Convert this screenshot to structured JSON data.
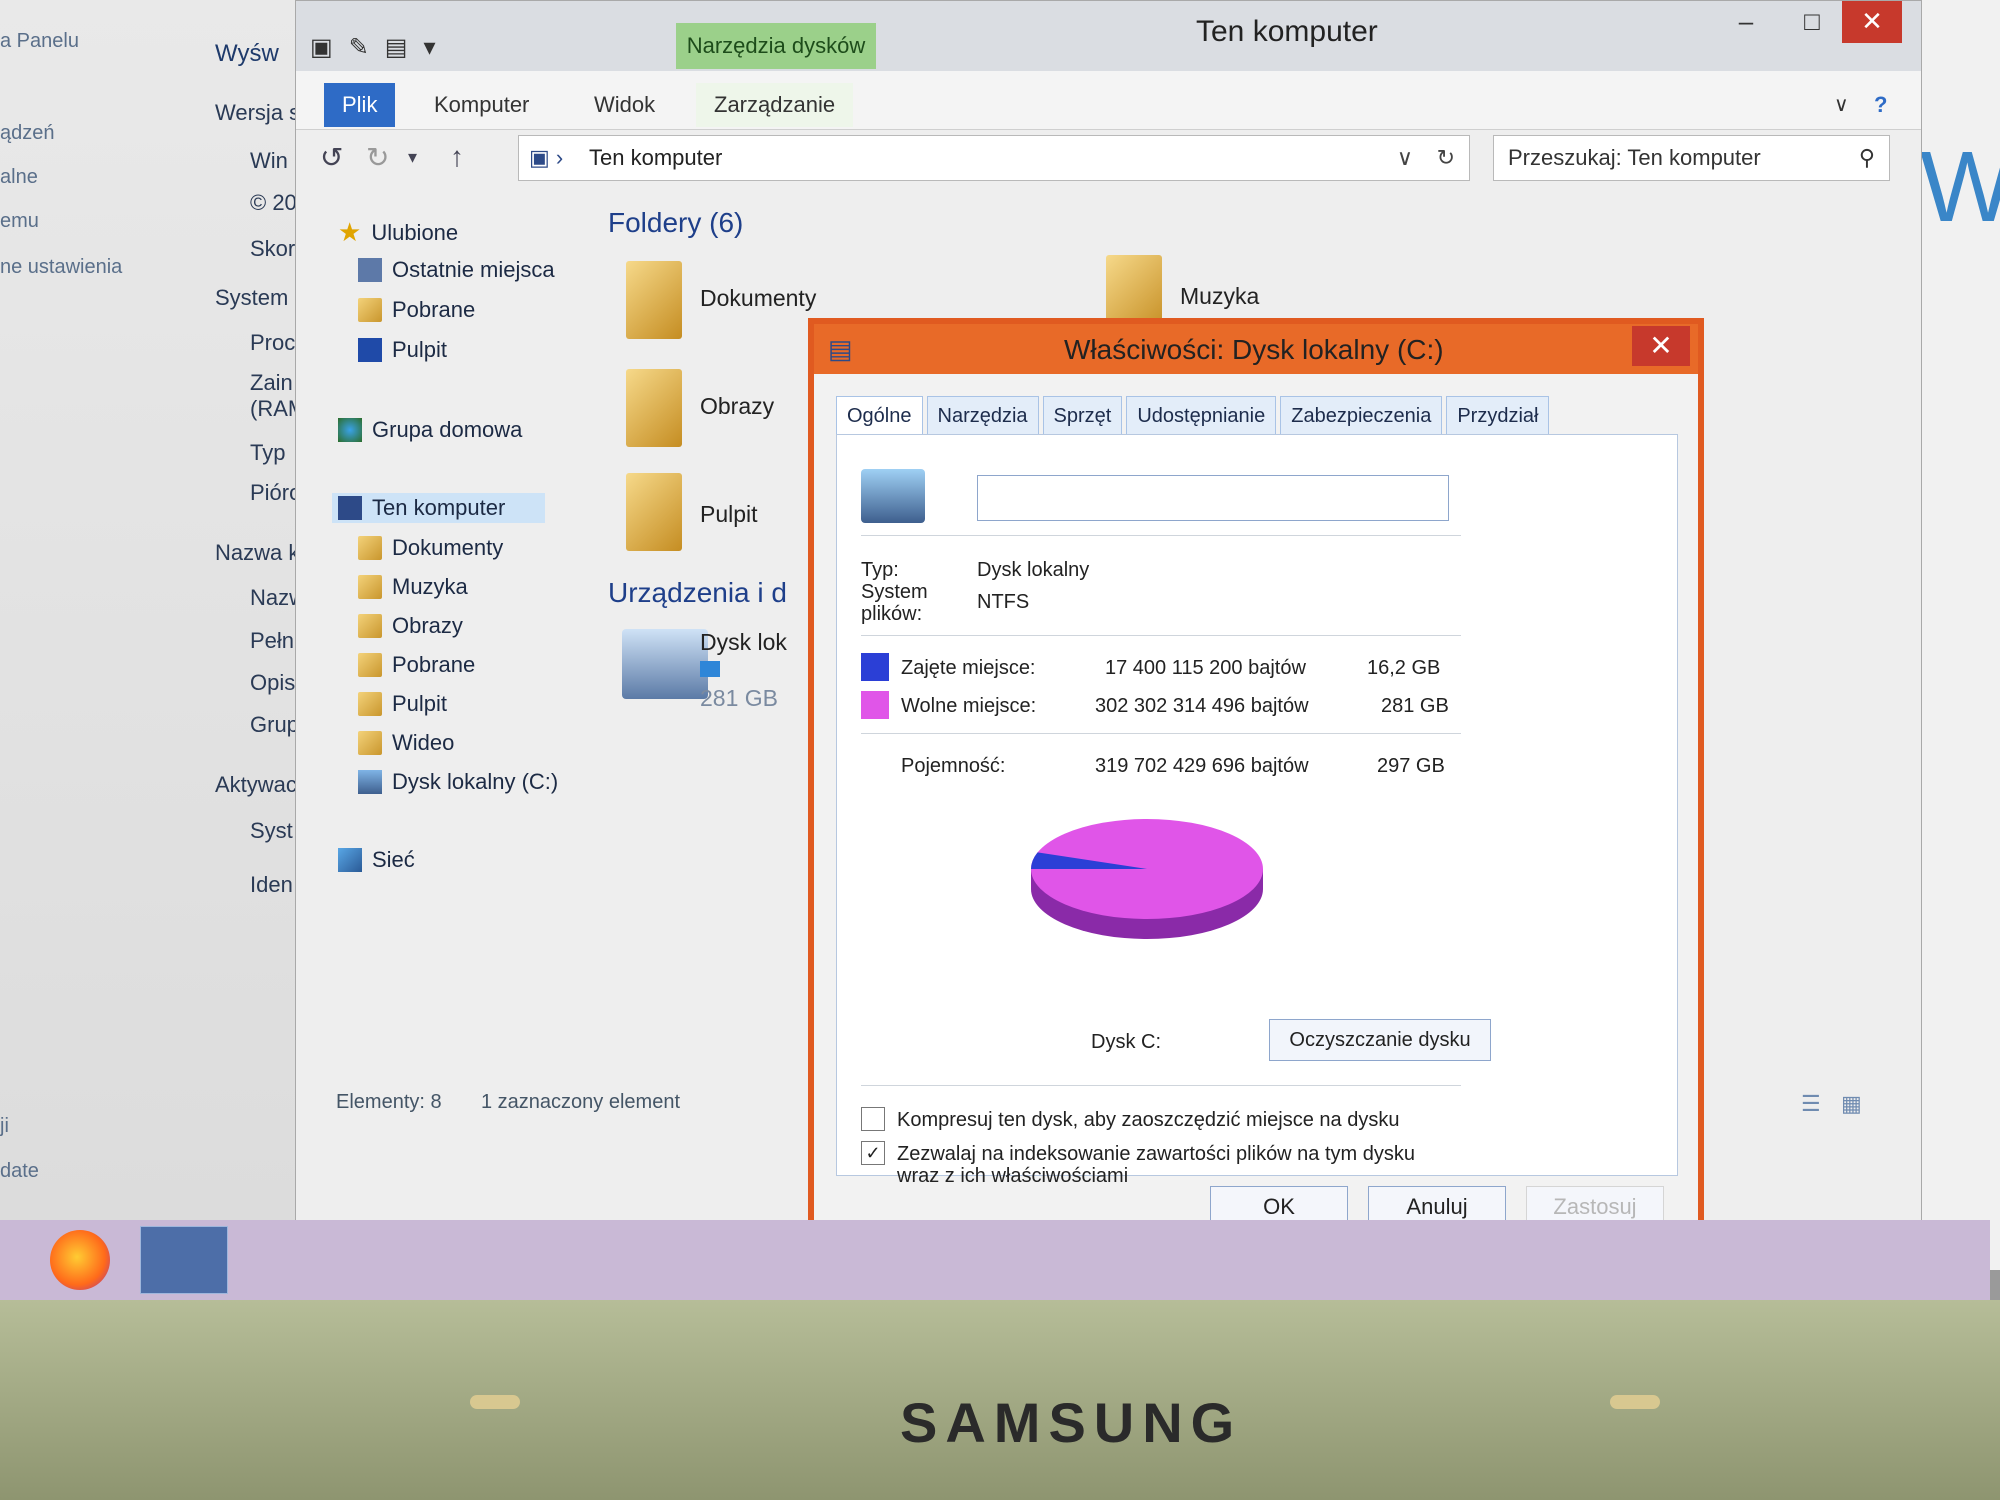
{
  "background_panel": {
    "left_links": [
      "a Panelu",
      "ądzeń",
      "alne",
      "emu",
      "ne ustawienia"
    ],
    "right_items": [
      "Wyśw",
      "Wersja s",
      "Win",
      "© 20",
      "Skor",
      "System",
      "Proc",
      "Zain (RAM",
      "Typ",
      "Pióro",
      "Nazwa k",
      "Nazw",
      "Pełn",
      "Opis",
      "Grup",
      "Aktywac",
      "Syst",
      "Iden"
    ],
    "bottom_left": [
      "ji",
      "date"
    ],
    "right_edge_text": "Wi"
  },
  "explorer": {
    "title": "Ten komputer",
    "context_tab_group": "Narzędzia dysków",
    "tabs": [
      "Plik",
      "Komputer",
      "Widok",
      "Zarządzanie"
    ],
    "address": "Ten komputer",
    "search_placeholder": "Przeszukaj: Ten komputer",
    "nav": {
      "favorites": "Ulubione",
      "favorites_items": [
        "Ostatnie miejsca",
        "Pobrane",
        "Pulpit"
      ],
      "homegroup": "Grupa domowa",
      "this_pc": "Ten komputer",
      "this_pc_items": [
        "Dokumenty",
        "Muzyka",
        "Obrazy",
        "Pobrane",
        "Pulpit",
        "Wideo",
        "Dysk lokalny (C:)"
      ],
      "network": "Sieć"
    },
    "folders_header": "Foldery (6)",
    "folders": [
      "Dokumenty",
      "Muzyka",
      "Obrazy",
      "Pulpit"
    ],
    "devices_header": "Urządzenia i d",
    "device_name": "Dysk lok",
    "device_size": "281 GB",
    "status_count": "Elementy: 8",
    "status_selected": "1 zaznaczony element"
  },
  "dialog": {
    "title": "Właściwości: Dysk lokalny (C:)",
    "tabs": [
      "Ogólne",
      "Narzędzia",
      "Sprzęt",
      "Udostępnianie",
      "Zabezpieczenia",
      "Przydział"
    ],
    "type_label": "Typ:",
    "type_value": "Dysk lokalny",
    "fs_label_1": "System",
    "fs_label_2": "plików:",
    "fs_value": "NTFS",
    "used_label": "Zajęte miejsce:",
    "used_bytes": "17 400 115 200 bajtów",
    "used_gb": "16,2 GB",
    "free_label": "Wolne miejsce:",
    "free_bytes": "302 302 314 496 bajtów",
    "free_gb": "281 GB",
    "capacity_label": "Pojemność:",
    "capacity_bytes": "319 702 429 696 bajtów",
    "capacity_gb": "297 GB",
    "pie_used_fraction": 0.054,
    "drive_label": "Dysk C:",
    "cleanup_button": "Oczyszczanie dysku",
    "compress_label": "Kompresuj ten dysk, aby zaoszczędzić miejsce na dysku",
    "compress_checked": false,
    "index_label_1": "Zezwalaj na indeksowanie zawartości plików na tym dysku",
    "index_label_2": "wraz z ich właściwościami",
    "index_checked": true,
    "ok": "OK",
    "cancel": "Anuluj",
    "apply": "Zastosuj",
    "colors": {
      "used": "#2b3fd6",
      "free": "#e055e8",
      "title_bar": "#e86a28"
    }
  },
  "bezel": {
    "brand": "SAMSUNG"
  }
}
